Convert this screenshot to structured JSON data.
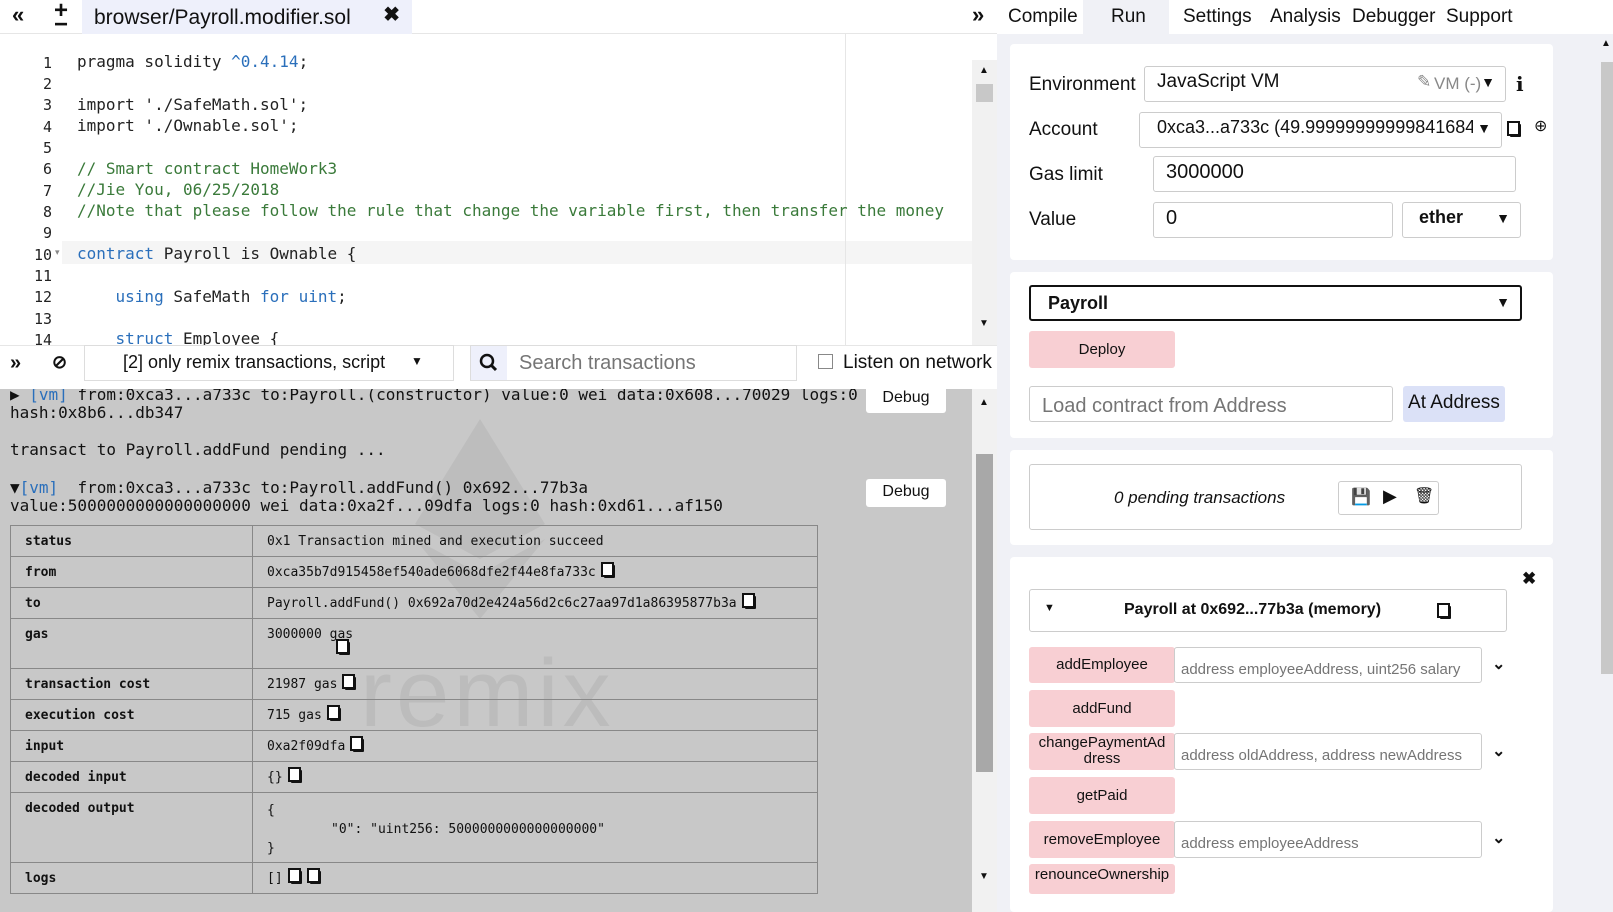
{
  "tab": {
    "title": "browser/Payroll.modifier.sol"
  },
  "editor": {
    "lines": [
      {
        "num": "1",
        "text": "pragma solidity ^0.4.14;"
      },
      {
        "num": "2",
        "text": ""
      },
      {
        "num": "3",
        "text": "import './SafeMath.sol';"
      },
      {
        "num": "4",
        "text": "import './Ownable.sol';"
      },
      {
        "num": "5",
        "text": ""
      },
      {
        "num": "6",
        "text": "// Smart contract HomeWork3"
      },
      {
        "num": "7",
        "text": "//Jie You, 06/25/2018"
      },
      {
        "num": "8",
        "text": "//Note that please follow the rule that change the variable first, then transfer the money"
      },
      {
        "num": "9",
        "text": ""
      },
      {
        "num": "10",
        "text": "contract Payroll is Ownable {"
      },
      {
        "num": "11",
        "text": ""
      },
      {
        "num": "12",
        "text": "    using SafeMath for uint;"
      },
      {
        "num": "13",
        "text": ""
      },
      {
        "num": "14",
        "text": "    struct Employee {"
      }
    ]
  },
  "terminal": {
    "filter": "[2] only remix transactions, script",
    "search_placeholder": "Search transactions",
    "listen_label": "Listen on network",
    "debug_label": "Debug",
    "tx1": {
      "tag": "[vm]",
      "line1": "from:0xca3...a733c to:Payroll.(constructor) value:0 wei data:0x608...70029 logs:0",
      "line2": "hash:0x8b6...db347"
    },
    "pending": "transact to Payroll.addFund pending ...",
    "tx2": {
      "tag": "[vm]",
      "line1": "from:0xca3...a733c to:Payroll.addFund() 0x692...77b3a",
      "line2": "value:5000000000000000000 wei data:0xa2f...09dfa logs:0 hash:0xd61...af150"
    },
    "details": {
      "status_k": "status",
      "status_v": "0x1 Transaction mined and execution succeed",
      "from_k": "from",
      "from_v": "0xca35b7d915458ef540ade6068dfe2f44e8fa733c",
      "to_k": "to",
      "to_v": "Payroll.addFund() 0x692a70d2e424a56d2c6c27aa97d1a86395877b3a",
      "gas_k": "gas",
      "gas_v": "3000000 gas",
      "tcost_k": "transaction cost",
      "tcost_v": "21987 gas",
      "ecost_k": "execution cost",
      "ecost_v": "715 gas",
      "input_k": "input",
      "input_v": "0xa2f09dfa",
      "dinput_k": "decoded input",
      "dinput_v": "{}",
      "doutput_k": "decoded output",
      "doutput_open": "{",
      "doutput_body": "\"0\": \"uint256: 5000000000000000000\"",
      "doutput_close": "}",
      "logs_k": "logs",
      "logs_v": "[]"
    },
    "watermark": "remix"
  },
  "nav": {
    "compile": "Compile",
    "run": "Run",
    "settings": "Settings",
    "analysis": "Analysis",
    "debugger": "Debugger",
    "support": "Support"
  },
  "run": {
    "env_label": "Environment",
    "env_value": "JavaScript VM",
    "env_vm": "VM (-)",
    "account_label": "Account",
    "account_value": "0xca3...a733c (49.99999999999841684",
    "gas_label": "Gas limit",
    "gas_value": "3000000",
    "value_label": "Value",
    "value_value": "0",
    "value_unit": "ether",
    "contract_select": "Payroll",
    "deploy": "Deploy",
    "load_placeholder": "Load contract from Address",
    "at_address": "At Address",
    "pending": "0 pending transactions",
    "instance_title": "Payroll at 0x692...77b3a (memory)",
    "functions": [
      {
        "name": "addEmployee",
        "placeholder": "address employeeAddress, uint256 salary"
      },
      {
        "name": "addFund",
        "placeholder": ""
      },
      {
        "name": "changePaymentAddress",
        "placeholder": "address oldAddress, address newAddress"
      },
      {
        "name": "getPaid",
        "placeholder": ""
      },
      {
        "name": "removeEmployee",
        "placeholder": "address employeeAddress"
      },
      {
        "name": "renounceOwnership",
        "placeholder": ""
      }
    ]
  },
  "colors": {
    "accent_pink": "#f8cfd3",
    "tab_bg": "#eef0fb",
    "terminal_bg": "#c8c8c8",
    "panel_bg": "#f0f1f6",
    "keyword": "#2a6fbb",
    "comment": "#3a7a3a"
  }
}
